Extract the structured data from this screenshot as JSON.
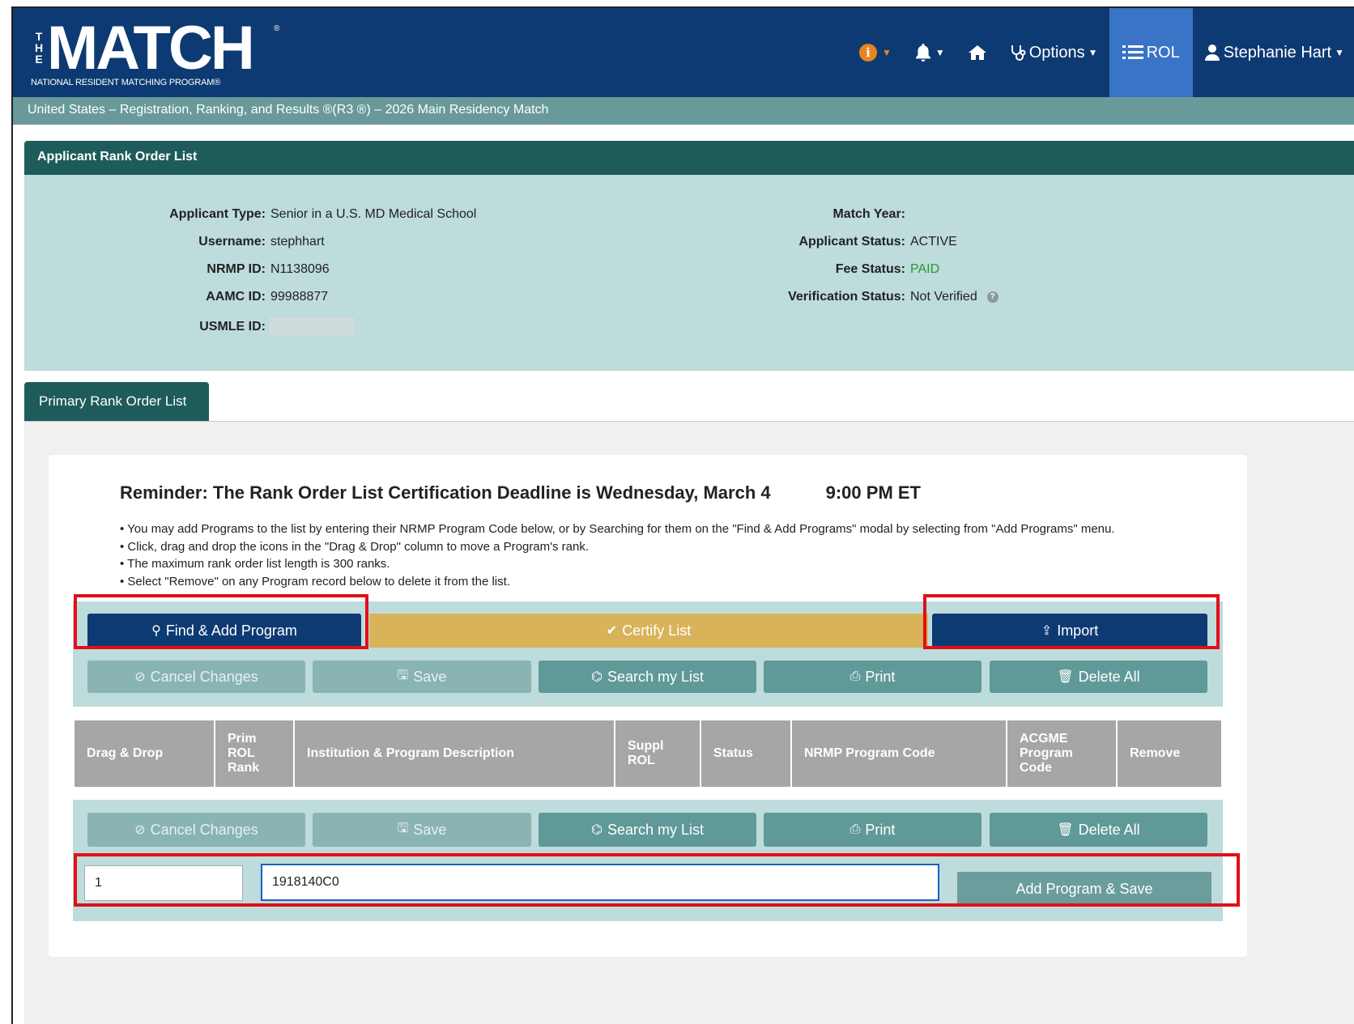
{
  "header": {
    "logo_the": "THE",
    "logo_match": "MATCH",
    "logo_reg": "®",
    "logo_sub": "NATIONAL RESIDENT MATCHING PROGRAM®",
    "nav": {
      "options_label": "Options",
      "rol_label": "ROL",
      "user_label": "Stephanie Hart"
    },
    "breadcrumb": "United States  –  Registration, Ranking, and Results ®(R3 ®)  –  2026 Main Residency Match"
  },
  "applicant": {
    "panel_title": "Applicant Rank Order List",
    "left": [
      {
        "label": "Applicant Type:",
        "value": "Senior in a U.S. MD Medical School"
      },
      {
        "label": "Username:",
        "value": "stephhart"
      },
      {
        "label": "NRMP ID:",
        "value": "N1138096"
      },
      {
        "label": "AAMC ID:",
        "value": "99988877"
      },
      {
        "label": "USMLE ID:",
        "value": ""
      }
    ],
    "right": [
      {
        "label": "Match Year:",
        "value": ""
      },
      {
        "label": "Applicant Status:",
        "value": "ACTIVE"
      },
      {
        "label": "Fee Status:",
        "value": "PAID"
      },
      {
        "label": "Verification Status:",
        "value": "Not Verified"
      }
    ]
  },
  "tab": {
    "label": "Primary Rank Order List"
  },
  "reminder": {
    "text": "Reminder: The Rank Order List Certification Deadline is Wednesday, March 4",
    "time": "9:00 PM ET"
  },
  "instructions": [
    "You may add Programs to the list by entering their NRMP Program Code below, or by Searching for them on the \"Find & Add Programs\" modal by selecting from \"Add Programs\" menu.",
    "Click, drag and drop the icons in the \"Drag & Drop\" column to move a Program's rank.",
    "The maximum rank order list length is 300 ranks.",
    "Select \"Remove\" on any Program record below to delete it from the list."
  ],
  "toolbar": {
    "find_add": "Find & Add Program",
    "certify": "Certify List",
    "import": "Import",
    "cancel": "Cancel Changes",
    "save": "Save",
    "search": "Search my List",
    "print": "Print",
    "delete_all": "Delete All"
  },
  "table": {
    "columns": [
      "Drag & Drop",
      "Prim ROL Rank",
      "Institution & Program Description",
      "Suppl ROL",
      "Status",
      "NRMP Program Code",
      "ACGME Program Code",
      "Remove"
    ]
  },
  "add_row": {
    "rank_value": "1",
    "code_value": "1918140C0",
    "add_button": "Add Program & Save"
  },
  "colors": {
    "navy": "#0e3a73",
    "teal": "#5f9998",
    "gold": "#d9b35a",
    "highlight": "#e0101a",
    "paid": "#2a9a2a"
  }
}
